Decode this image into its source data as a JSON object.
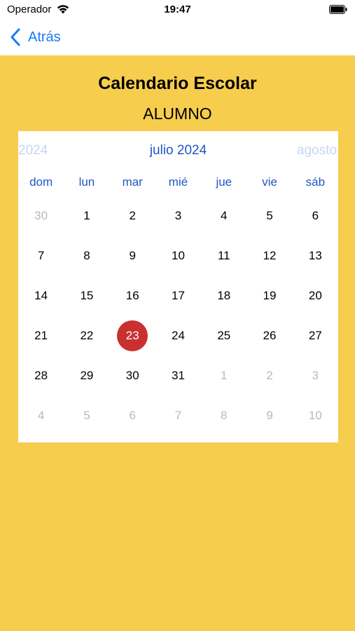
{
  "status_bar": {
    "carrier": "Operador",
    "time": "19:47"
  },
  "nav": {
    "back_label": "Atrás"
  },
  "page": {
    "title": "Calendario Escolar",
    "subtitle": "ALUMNO"
  },
  "calendar": {
    "prev_month": "2024",
    "current_month": "julio 2024",
    "next_month": "agosto",
    "weekdays": [
      "dom",
      "lun",
      "mar",
      "mié",
      "jue",
      "vie",
      "sáb"
    ],
    "weeks": [
      [
        {
          "d": "30",
          "m": true
        },
        {
          "d": "1"
        },
        {
          "d": "2"
        },
        {
          "d": "3"
        },
        {
          "d": "4"
        },
        {
          "d": "5"
        },
        {
          "d": "6"
        }
      ],
      [
        {
          "d": "7"
        },
        {
          "d": "8"
        },
        {
          "d": "9"
        },
        {
          "d": "10"
        },
        {
          "d": "11"
        },
        {
          "d": "12"
        },
        {
          "d": "13"
        }
      ],
      [
        {
          "d": "14"
        },
        {
          "d": "15"
        },
        {
          "d": "16"
        },
        {
          "d": "17"
        },
        {
          "d": "18"
        },
        {
          "d": "19"
        },
        {
          "d": "20"
        }
      ],
      [
        {
          "d": "21"
        },
        {
          "d": "22"
        },
        {
          "d": "23",
          "s": true
        },
        {
          "d": "24"
        },
        {
          "d": "25"
        },
        {
          "d": "26"
        },
        {
          "d": "27"
        }
      ],
      [
        {
          "d": "28"
        },
        {
          "d": "29"
        },
        {
          "d": "30"
        },
        {
          "d": "31"
        },
        {
          "d": "1",
          "m": true
        },
        {
          "d": "2",
          "m": true
        },
        {
          "d": "3",
          "m": true
        }
      ],
      [
        {
          "d": "4",
          "m": true
        },
        {
          "d": "5",
          "m": true
        },
        {
          "d": "6",
          "m": true
        },
        {
          "d": "7",
          "m": true
        },
        {
          "d": "8",
          "m": true
        },
        {
          "d": "9",
          "m": true
        },
        {
          "d": "10",
          "m": true
        }
      ]
    ]
  },
  "colors": {
    "background": "#f7cd4e",
    "accent": "#1f57c4",
    "link": "#1a7af5",
    "selected": "#c93030",
    "muted": "#b9b9b9"
  },
  "icons": {
    "wifi": "wifi-icon",
    "battery": "battery-icon",
    "back": "chevron-left-icon"
  }
}
